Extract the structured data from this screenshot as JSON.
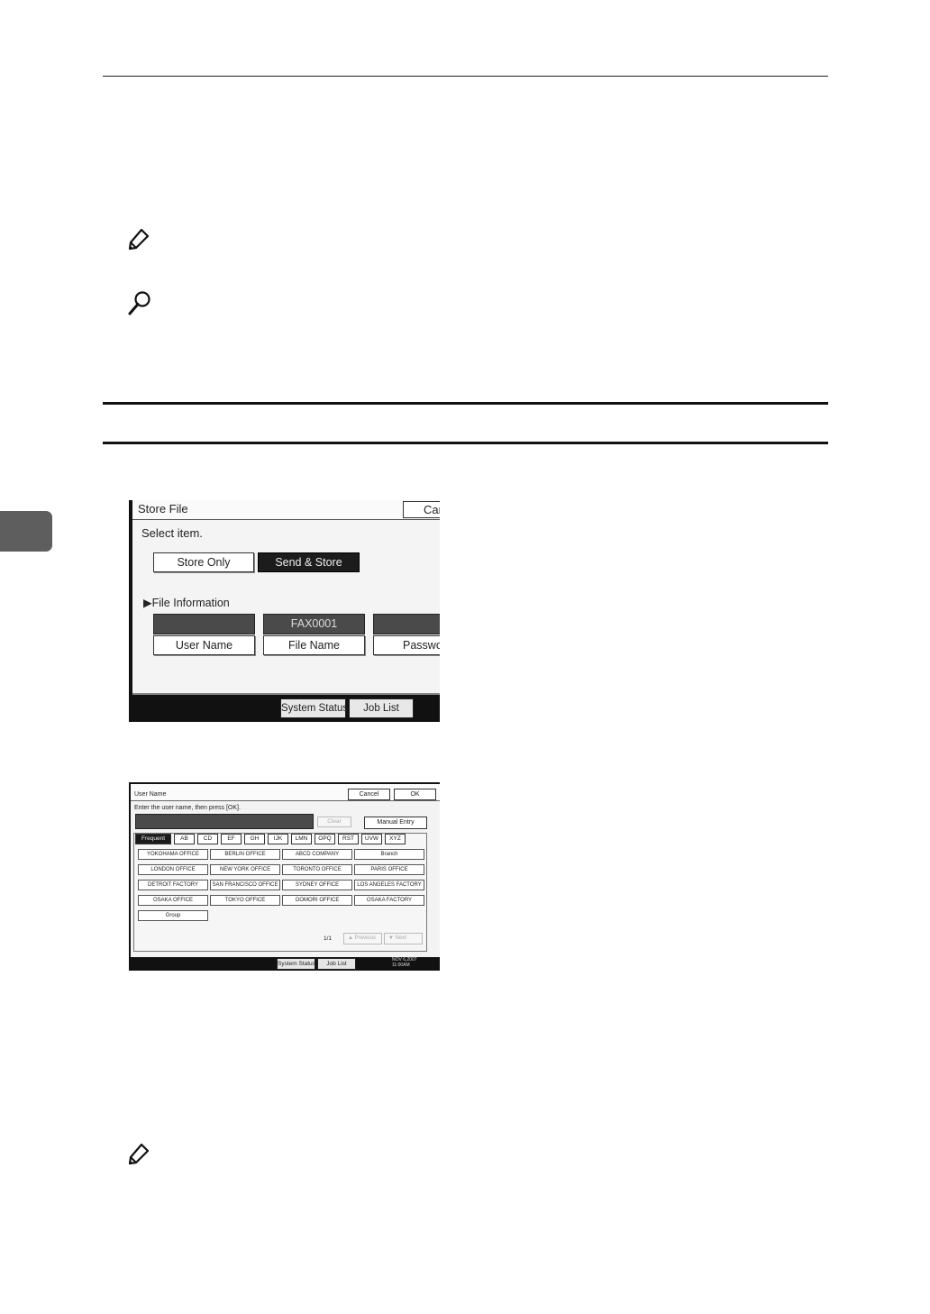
{
  "store_file_screen": {
    "title": "Store File",
    "cancel_label": "Can",
    "prompt": "Select item.",
    "store_only_label": "Store Only",
    "send_store_label": "Send & Store",
    "file_info_label": "▶File Information",
    "fields": {
      "user_name": {
        "value": "",
        "label": "User Name"
      },
      "file_name": {
        "value": "FAX0001",
        "label": "File Name"
      },
      "password": {
        "value": "",
        "label": "Passwor"
      }
    },
    "system_status_label": "System Status",
    "job_list_label": "Job List"
  },
  "user_name_screen": {
    "title": "User Name",
    "cancel_label": "Cancel",
    "ok_label": "OK",
    "prompt": "Enter the user name, then press [OK].",
    "clear_label": "Clear",
    "manual_entry_label": "Manual Entry",
    "tabs": [
      "Frequent",
      "AB",
      "CD",
      "EF",
      "GH",
      "IJK",
      "LMN",
      "OPQ",
      "RST",
      "UVW",
      "XYZ"
    ],
    "destinations": [
      "YOKOHAMA OFFICE",
      "BERLIN OFFICE",
      "ABCD COMPANY",
      "Branch",
      "LONDON OFFICE",
      "NEW YORK OFFICE",
      "TORONTO OFFICE",
      "PARIS OFFICE",
      "DETROIT FACTORY",
      "SAN FRANCISCO OFFICE",
      "SYDNEY OFFICE",
      "LOS ANGELES FACTORY",
      "OSAKA OFFICE",
      "TOKYO OFFICE",
      "OOMORI OFFICE",
      "OSAKA FACTORY",
      "Group"
    ],
    "page_count": "1/1",
    "prev_label": "▲  Previous",
    "next_label": "▼  Next",
    "system_status_label": "System Status",
    "job_list_label": "Job List",
    "date_line_1": "NOV   6,2007",
    "date_line_2": "11:00AM"
  }
}
